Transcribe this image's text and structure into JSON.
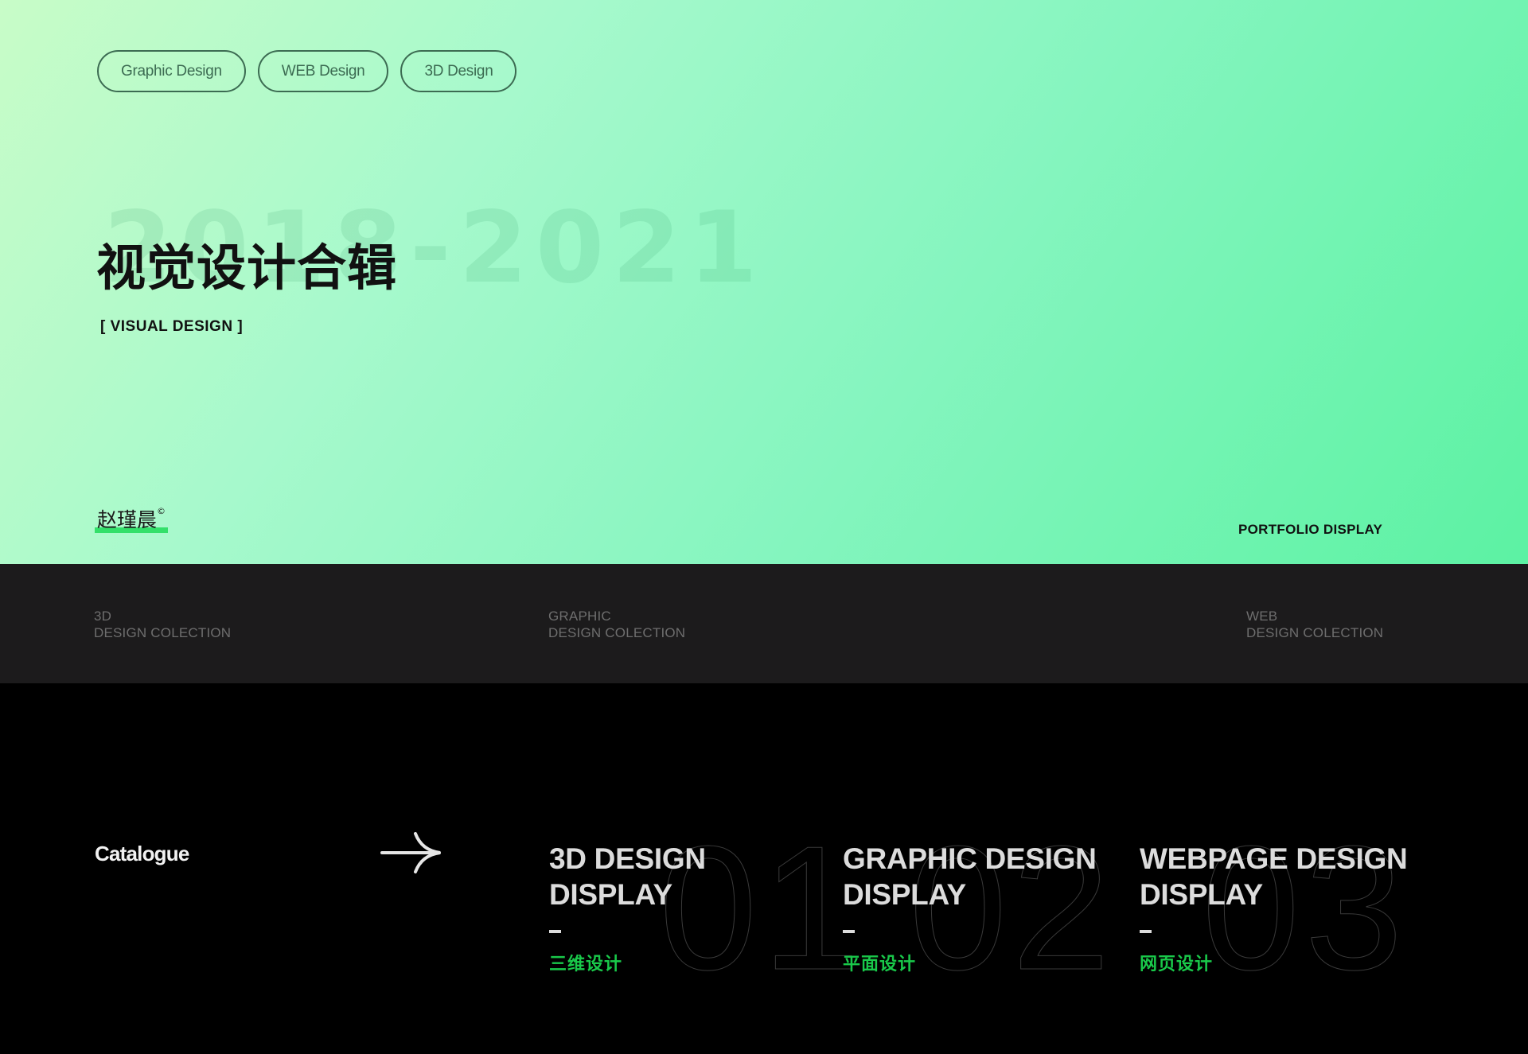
{
  "hero": {
    "tags": [
      "Graphic Design",
      "WEB Design",
      "3D Design"
    ],
    "year_range": "2018-2021",
    "title_cn": "视觉设计合辑",
    "title_en": "[ VISUAL DESIGN ]",
    "signature": "赵瑾晨",
    "signature_mark": "©",
    "portfolio_label": "PORTFOLIO DISPLAY",
    "colors": {
      "gradient_start": "#c8fcc8",
      "gradient_end": "#5cf2a3",
      "accent_green": "#33e06a"
    }
  },
  "strip": {
    "items": [
      {
        "line1": "3D",
        "line2": "DESIGN COLECTION"
      },
      {
        "line1": "GRAPHIC",
        "line2": "DESIGN COLECTION"
      },
      {
        "line1": "WEB",
        "line2": "DESIGN COLECTION"
      }
    ]
  },
  "catalogue": {
    "title": "Catalogue",
    "arrow_icon": "arrow-right-icon",
    "entries": [
      {
        "number": "01",
        "title_line1": "3D DESIGN",
        "title_line2": "DISPLAY",
        "subtitle_cn": "三维设计"
      },
      {
        "number": "02",
        "title_line1": "GRAPHIC DESIGN",
        "title_line2": "DISPLAY",
        "subtitle_cn": "平面设计"
      },
      {
        "number": "03",
        "title_line1": "WEBPAGE DESIGN",
        "title_line2": "DISPLAY",
        "subtitle_cn": "网页设计"
      }
    ],
    "colors": {
      "subtitle_green": "#19c94a"
    }
  }
}
